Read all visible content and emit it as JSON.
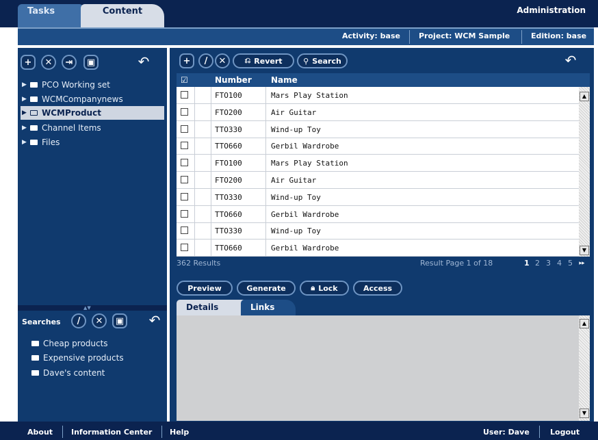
{
  "top_tabs": {
    "tasks": "Tasks",
    "content": "Content"
  },
  "admin": "Administration",
  "subbar": {
    "activity": "Activity: base",
    "project": "Project: WCM Sample",
    "edition": "Edition: base"
  },
  "tree": [
    {
      "label": "PCO Working set"
    },
    {
      "label": "WCMCompanynews"
    },
    {
      "label": "WCMProduct"
    },
    {
      "label": "Channel Items"
    },
    {
      "label": "Files"
    }
  ],
  "searches": {
    "title": "Searches",
    "items": [
      "Cheap products",
      "Expensive products",
      "Dave's content"
    ]
  },
  "toolbar": {
    "revert": "Revert",
    "search": "Search"
  },
  "table": {
    "headers": {
      "number": "Number",
      "name": "Name"
    },
    "rows": [
      {
        "number": "FTO100",
        "name": "Mars Play Station"
      },
      {
        "number": "FTO200",
        "name": "Air Guitar"
      },
      {
        "number": "TTO330",
        "name": "Wind-up Toy"
      },
      {
        "number": "TTO660",
        "name": "Gerbil Wardrobe"
      },
      {
        "number": "FTO100",
        "name": "Mars Play Station"
      },
      {
        "number": "FTO200",
        "name": "Air Guitar"
      },
      {
        "number": "TTO330",
        "name": "Wind-up Toy"
      },
      {
        "number": "TTO660",
        "name": "Gerbil Wardrobe"
      },
      {
        "number": "TTO330",
        "name": "Wind-up Toy"
      },
      {
        "number": "TTO660",
        "name": "Gerbil Wardrobe"
      }
    ]
  },
  "results": {
    "count": "362 Results",
    "page": "Result Page 1 of 18",
    "pages": [
      "1",
      "2",
      "3",
      "4",
      "5"
    ]
  },
  "actions": {
    "preview": "Preview",
    "generate": "Generate",
    "lock": "Lock",
    "access": "Access"
  },
  "detail_tabs": {
    "details": "Details",
    "links": "Links"
  },
  "footer": {
    "about": "About",
    "info": "Information Center",
    "help": "Help",
    "user": "User: Dave",
    "logout": "Logout"
  },
  "colors": {
    "navy": "#0b2350",
    "panel": "#103a6e",
    "header": "#1d4d86",
    "tab_light": "#d7dde7"
  }
}
